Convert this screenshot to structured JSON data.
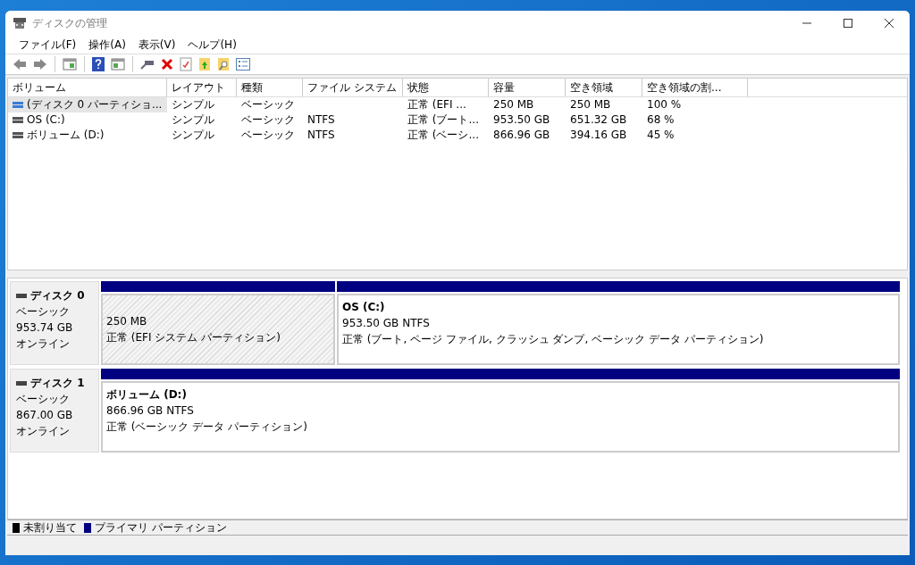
{
  "window": {
    "title": "ディスクの管理"
  },
  "menu": [
    "ファイル(F)",
    "操作(A)",
    "表示(V)",
    "ヘルプ(H)"
  ],
  "volume_table": {
    "columns": [
      "ボリューム",
      "レイアウト",
      "種類",
      "ファイル システム",
      "状態",
      "容量",
      "空き領域",
      "空き領域の割..."
    ],
    "rows": [
      {
        "selected": true,
        "cells": [
          "(ディスク 0 パーティショ...",
          "シンプル",
          "ベーシック",
          "",
          "正常 (EFI ...",
          "250 MB",
          "250 MB",
          "100 %"
        ]
      },
      {
        "selected": false,
        "cells": [
          "OS (C:)",
          "シンプル",
          "ベーシック",
          "NTFS",
          "正常 (ブート...",
          "953.50 GB",
          "651.32 GB",
          "68 %"
        ]
      },
      {
        "selected": false,
        "cells": [
          "ボリューム (D:)",
          "シンプル",
          "ベーシック",
          "NTFS",
          "正常 (ベーシ...",
          "866.96 GB",
          "394.16 GB",
          "45 %"
        ]
      }
    ]
  },
  "disks": [
    {
      "name": "ディスク 0",
      "type": "ベーシック",
      "size": "953.74 GB",
      "status": "オンライン",
      "partitions": [
        {
          "kind": "efi",
          "size": "250 MB",
          "status": "正常 (EFI システム パーティション)"
        },
        {
          "kind": "primary",
          "label": "OS  (C:)",
          "size": "953.50 GB NTFS",
          "status": "正常 (ブート, ページ ファイル, クラッシュ ダンプ, ベーシック データ パーティション)"
        }
      ]
    },
    {
      "name": "ディスク 1",
      "type": "ベーシック",
      "size": "867.00 GB",
      "status": "オンライン",
      "partitions": [
        {
          "kind": "primary",
          "label": "ボリューム  (D:)",
          "size": "866.96 GB NTFS",
          "status": "正常 (ベーシック データ パーティション)"
        }
      ]
    }
  ],
  "legend": [
    {
      "label": "未割り当て",
      "color": "#000000"
    },
    {
      "label": "プライマリ パーティション",
      "color": "#000080"
    }
  ]
}
